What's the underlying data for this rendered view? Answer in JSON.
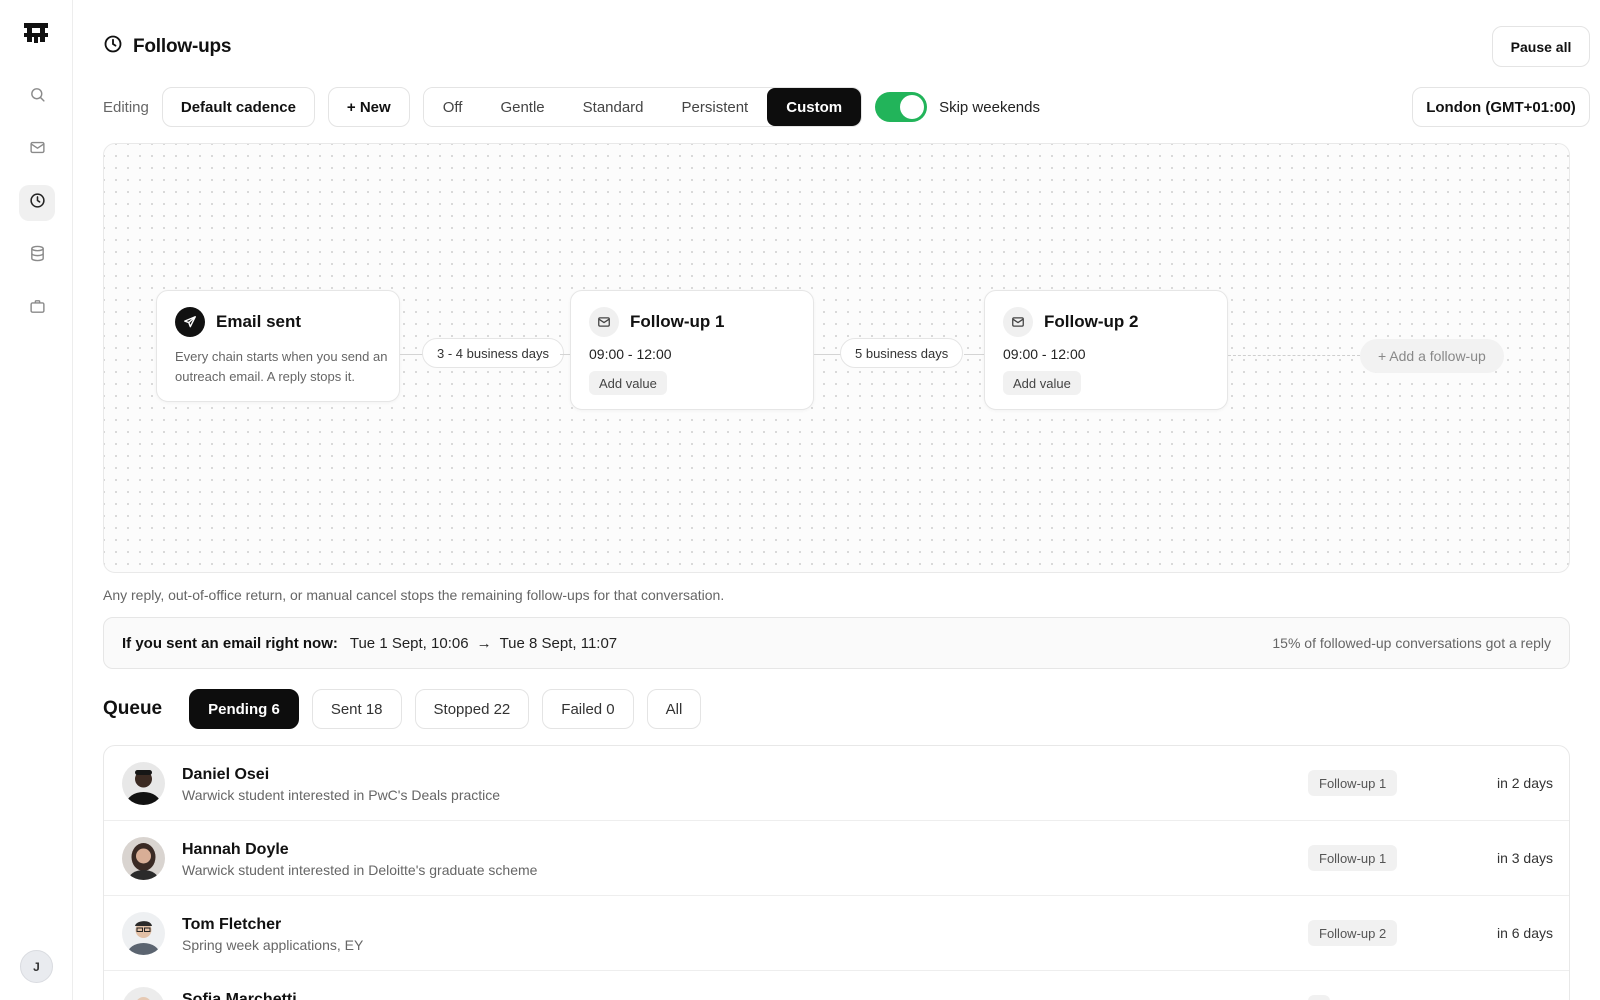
{
  "app": {
    "user_initial": "J"
  },
  "sidebar": {
    "items": [
      {
        "name": "search",
        "icon": "search-icon"
      },
      {
        "name": "mail",
        "icon": "mail-icon"
      },
      {
        "name": "followups",
        "icon": "clock-icon",
        "active": true
      },
      {
        "name": "database",
        "icon": "database-icon"
      },
      {
        "name": "briefcase",
        "icon": "briefcase-icon"
      }
    ]
  },
  "header": {
    "title": "Follow-ups",
    "pause_label": "Pause all"
  },
  "toolbar": {
    "editing_label": "Editing",
    "cadence_name": "Default cadence",
    "new_label": "+ New",
    "presets": [
      "Off",
      "Gentle",
      "Standard",
      "Persistent",
      "Custom"
    ],
    "active_preset": "Custom",
    "skip_weekends_label": "Skip weekends",
    "skip_weekends_on": true,
    "timezone": "London (GMT+01:00)",
    "toggle_color": "#22b45a"
  },
  "flow": {
    "start": {
      "title": "Email sent",
      "description": "Every chain starts when you send an outreach email. A reply stops it."
    },
    "gap1": "3 - 4 business days",
    "followup1": {
      "title": "Follow-up 1",
      "time": "09:00 - 12:00",
      "add_value": "Add value"
    },
    "gap2": "5 business days",
    "followup2": {
      "title": "Follow-up 2",
      "time": "09:00 - 12:00",
      "add_value": "Add value"
    },
    "add_label": "+ Add a follow-up"
  },
  "hint": "Any reply, out-of-office return, or manual cancel stops the remaining follow-ups for that conversation.",
  "preview": {
    "label": "If you sent an email right now:",
    "from": "Tue 1 Sept, 10:06",
    "arrow": "→",
    "to": "Tue 8 Sept, 11:07",
    "stat": "15% of followed-up conversations got a reply"
  },
  "queue": {
    "title": "Queue",
    "tabs": [
      "Pending 6",
      "Sent 18",
      "Stopped 22",
      "Failed 0",
      "All"
    ],
    "active_tab": "Pending 6",
    "rows": [
      {
        "name": "Daniel Osei",
        "subtitle": "Warwick student interested in PwC's Deals practice",
        "stage": "Follow-up 1",
        "when": "in 2 days"
      },
      {
        "name": "Hannah Doyle",
        "subtitle": "Warwick student interested in Deloitte's graduate scheme",
        "stage": "Follow-up 1",
        "when": "in 3 days"
      },
      {
        "name": "Tom Fletcher",
        "subtitle": "Spring week applications, EY",
        "stage": "Follow-up 2",
        "when": "in 6 days"
      },
      {
        "name": "Sofia Marchetti",
        "subtitle": "",
        "stage": "",
        "when": ""
      }
    ]
  }
}
